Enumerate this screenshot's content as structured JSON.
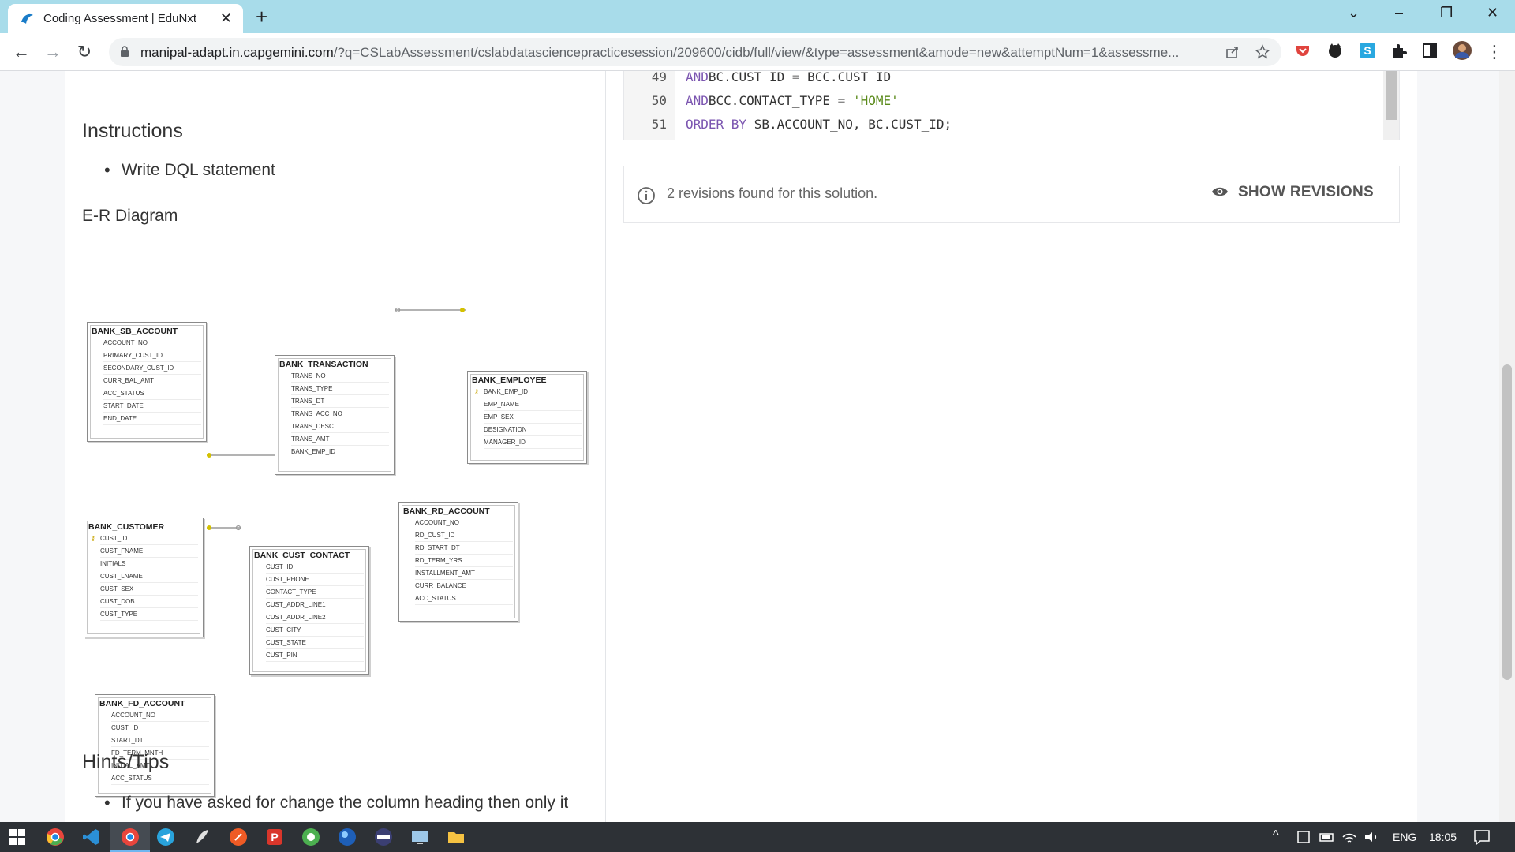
{
  "browser": {
    "tab_title": "Coding Assessment | EduNxt",
    "url_host": "manipal-adapt.in.capgemini.com",
    "url_path": "/?q=CSLabAssessment/cslabdatasciencepracticesession/209600/cidb/full/view/&type=assessment&amode=new&attemptNum=1&assessme..."
  },
  "left": {
    "instructions_heading": "Instructions",
    "instruction_item": "Write DQL statement",
    "er_label": "E-R Diagram",
    "hints_heading": "Hints/Tips",
    "hint_item": "If you have asked for change the column heading then only it"
  },
  "er_entities": [
    {
      "name": "BANK_SB_ACCOUNT",
      "columns": [
        "ACCOUNT_NO",
        "PRIMARY_CUST_ID",
        "SECONDARY_CUST_ID",
        "CURR_BAL_AMT",
        "ACC_STATUS",
        "START_DATE",
        "END_DATE"
      ]
    },
    {
      "name": "BANK_TRANSACTION",
      "columns": [
        "TRANS_NO",
        "TRANS_TYPE",
        "TRANS_DT",
        "TRANS_ACC_NO",
        "TRANS_DESC",
        "TRANS_AMT",
        "BANK_EMP_ID"
      ]
    },
    {
      "name": "BANK_EMPLOYEE",
      "columns": [
        "BANK_EMP_ID",
        "EMP_NAME",
        "EMP_SEX",
        "DESIGNATION",
        "MANAGER_ID"
      ]
    },
    {
      "name": "BANK_RD_ACCOUNT",
      "columns": [
        "ACCOUNT_NO",
        "RD_CUST_ID",
        "RD_START_DT",
        "RD_TERM_YRS",
        "INSTALLMENT_AMT",
        "CURR_BALANCE",
        "ACC_STATUS"
      ]
    },
    {
      "name": "BANK_CUSTOMER",
      "columns": [
        "CUST_ID",
        "CUST_FNAME",
        "INITIALS",
        "CUST_LNAME",
        "CUST_SEX",
        "CUST_DOB",
        "CUST_TYPE"
      ]
    },
    {
      "name": "BANK_CUST_CONTACT",
      "columns": [
        "CUST_ID",
        "CUST_PHONE",
        "CONTACT_TYPE",
        "CUST_ADDR_LINE1",
        "CUST_ADDR_LINE2",
        "CUST_CITY",
        "CUST_STATE",
        "CUST_PIN"
      ]
    },
    {
      "name": "BANK_FD_ACCOUNT",
      "columns": [
        "ACCOUNT_NO",
        "CUST_ID",
        "START_DT",
        "FD_TERM_MNTH",
        "INITIAL_AMT",
        "ACC_STATUS"
      ]
    }
  ],
  "code": {
    "lines": [
      {
        "no": "49",
        "tokens": [
          [
            "kw",
            "AND"
          ],
          [
            "",
            "BC.CUST_ID "
          ],
          [
            "op",
            "="
          ],
          [
            "",
            " BCC.CUST_ID"
          ]
        ]
      },
      {
        "no": "50",
        "tokens": [
          [
            "kw",
            "AND"
          ],
          [
            "",
            "BCC.CONTACT_TYPE "
          ],
          [
            "op",
            "="
          ],
          [
            "",
            " "
          ],
          [
            "str",
            "'HOME'"
          ]
        ]
      },
      {
        "no": "51",
        "tokens": [
          [
            "kw",
            "ORDER BY"
          ],
          [
            "",
            " SB.ACCOUNT_NO, BC.CUST_ID;"
          ]
        ]
      }
    ]
  },
  "revisions": {
    "text": "2 revisions found for this solution.",
    "button": "SHOW REVISIONS"
  },
  "taskbar": {
    "lang": "ENG",
    "time": "18:05"
  },
  "colors": {
    "tabstrip": "#a8dcea",
    "taskbar": "#2d3136",
    "keyword": "#7b55b0",
    "string": "#5a8a1a"
  }
}
